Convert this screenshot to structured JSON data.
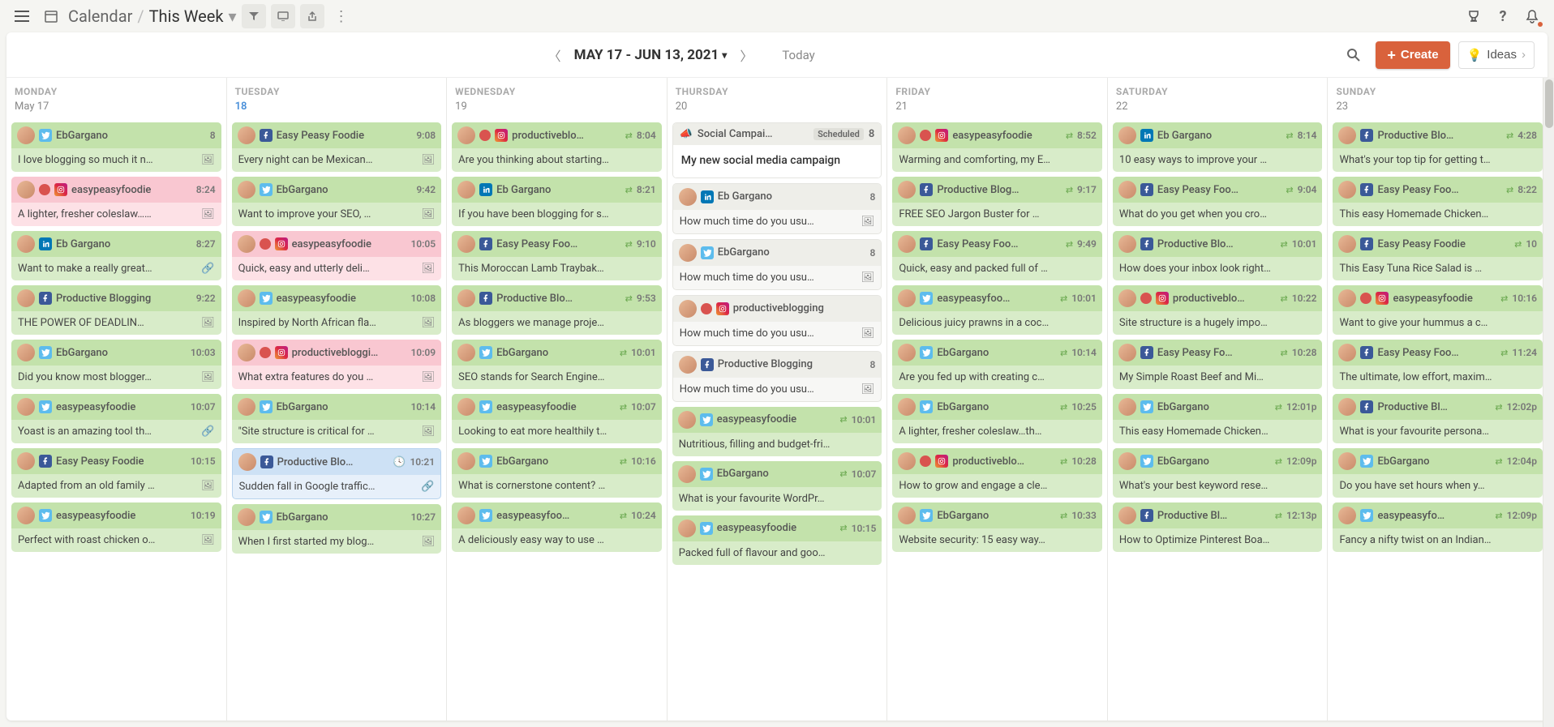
{
  "breadcrumb": {
    "app": "Calendar",
    "view": "This Week"
  },
  "controls": {
    "date_range": "MAY 17 - JUN 13, 2021",
    "today": "Today",
    "create": "Create",
    "ideas": "Ideas"
  },
  "days": [
    {
      "name": "MONDAY",
      "date": "May 17",
      "today": false
    },
    {
      "name": "TUESDAY",
      "date": "18",
      "today": true
    },
    {
      "name": "WEDNESDAY",
      "date": "19",
      "today": false
    },
    {
      "name": "THURSDAY",
      "date": "20",
      "today": false
    },
    {
      "name": "FRIDAY",
      "date": "21",
      "today": false
    },
    {
      "name": "SATURDAY",
      "date": "22",
      "today": false
    },
    {
      "name": "SUNDAY",
      "date": "23",
      "today": false
    }
  ],
  "cards": {
    "mon": [
      {
        "style": "green",
        "net": "tw",
        "acct": "EbGargano",
        "time": "8",
        "shuffle": false,
        "text": "I love blogging so much it n…",
        "img": true
      },
      {
        "style": "pink",
        "net": "ig",
        "acct": "easypeasyfoodie",
        "time": "8:24",
        "shuffle": false,
        "user": true,
        "text": "A lighter, fresher coleslaw……",
        "img": true
      },
      {
        "style": "green",
        "net": "li",
        "acct": "Eb Gargano",
        "time": "8:27",
        "shuffle": false,
        "text": "Want to make a really great…",
        "link": true
      },
      {
        "style": "green",
        "net": "fb",
        "acct": "Productive Blogging",
        "time": "9:22",
        "shuffle": false,
        "text": "THE POWER OF DEADLIN…",
        "img": true
      },
      {
        "style": "green",
        "net": "tw",
        "acct": "EbGargano",
        "time": "10:03",
        "shuffle": false,
        "text": "Did you know most blogger…",
        "img": true
      },
      {
        "style": "green",
        "net": "tw",
        "acct": "easypeasyfoodie",
        "time": "10:07",
        "shuffle": false,
        "text": "Yoast is an amazing tool th…",
        "link": true
      },
      {
        "style": "green",
        "net": "fb",
        "acct": "Easy Peasy Foodie",
        "time": "10:15",
        "shuffle": false,
        "text": "Adapted from an old family …",
        "img": true
      },
      {
        "style": "green",
        "net": "tw",
        "acct": "easypeasyfoodie",
        "time": "10:19",
        "shuffle": false,
        "text": "Perfect with roast chicken o…",
        "img": true
      }
    ],
    "tue": [
      {
        "style": "green",
        "net": "fb",
        "acct": "Easy Peasy Foodie",
        "time": "9:08",
        "shuffle": false,
        "text": "Every night can be Mexican…",
        "img": true
      },
      {
        "style": "green",
        "net": "tw",
        "acct": "EbGargano",
        "time": "9:42",
        "shuffle": false,
        "text": "Want to improve your SEO, …",
        "img": true
      },
      {
        "style": "pink",
        "net": "ig",
        "acct": "easypeasyfoodie",
        "time": "10:05",
        "shuffle": false,
        "user": true,
        "text": "Quick, easy and utterly deli…",
        "img": true
      },
      {
        "style": "green",
        "net": "tw",
        "acct": "easypeasyfoodie",
        "time": "10:08",
        "shuffle": false,
        "text": "Inspired by North African fla…",
        "img": true
      },
      {
        "style": "pink",
        "net": "ig",
        "acct": "productivebloggi…",
        "time": "10:09",
        "shuffle": false,
        "user": true,
        "text": "What extra features do you …",
        "img": true
      },
      {
        "style": "green",
        "net": "tw",
        "acct": "EbGargano",
        "time": "10:14",
        "shuffle": false,
        "text": "\"Site structure is critical for …",
        "img": true
      },
      {
        "style": "blue",
        "net": "fb",
        "acct": "Productive Blo…",
        "time": "10:21",
        "shuffle": false,
        "clock": true,
        "text": "Sudden fall in Google traffic…",
        "link": true
      },
      {
        "style": "green",
        "net": "tw",
        "acct": "EbGargano",
        "time": "10:27",
        "shuffle": false,
        "text": "When I first started my blog…",
        "img": true
      }
    ],
    "wed": [
      {
        "style": "green",
        "net": "ig",
        "acct": "productiveblo…",
        "time": "8:04",
        "shuffle": true,
        "user": true,
        "text": "Are you thinking about starting…"
      },
      {
        "style": "green",
        "net": "li",
        "acct": "Eb Gargano",
        "time": "8:21",
        "shuffle": true,
        "text": "If you have been blogging for s…"
      },
      {
        "style": "green",
        "net": "fb",
        "acct": "Easy Peasy Foo…",
        "time": "9:10",
        "shuffle": true,
        "text": "This Moroccan Lamb Traybak…"
      },
      {
        "style": "green",
        "net": "fb",
        "acct": "Productive Blo…",
        "time": "9:53",
        "shuffle": true,
        "text": "As bloggers we manage proje…"
      },
      {
        "style": "green",
        "net": "tw",
        "acct": "EbGargano",
        "time": "10:01",
        "shuffle": true,
        "text": "SEO stands for Search Engine…"
      },
      {
        "style": "green",
        "net": "tw",
        "acct": "easypeasyfoodie",
        "time": "10:07",
        "shuffle": true,
        "text": "Looking to eat more healthily t…"
      },
      {
        "style": "green",
        "net": "tw",
        "acct": "EbGargano",
        "time": "10:16",
        "shuffle": true,
        "text": "What is cornerstone content? …"
      },
      {
        "style": "green",
        "net": "tw",
        "acct": "easypeasyfoo…",
        "time": "10:24",
        "shuffle": true,
        "text": "A deliciously easy way to use …"
      }
    ],
    "thu": [
      {
        "style": "campaign",
        "title": "Social Campai…",
        "status": "Scheduled",
        "count": "8",
        "text": "My new social media campaign"
      },
      {
        "style": "gray",
        "net": "li",
        "acct": "Eb Gargano",
        "time": "8",
        "text": "How much time do you usu…",
        "img": true
      },
      {
        "style": "gray",
        "net": "tw",
        "acct": "EbGargano",
        "time": "8",
        "text": "How much time do you usu…",
        "img": true
      },
      {
        "style": "gray",
        "net": "ig",
        "acct": "productiveblogging",
        "time": "",
        "user": true,
        "text": "How much time do you usu…",
        "img": true
      },
      {
        "style": "gray",
        "net": "fb",
        "acct": "Productive Blogging",
        "time": "8",
        "text": "How much time do you usu…",
        "img": true
      },
      {
        "style": "green",
        "net": "tw",
        "acct": "easypeasyfoodie",
        "time": "10:01",
        "shuffle": true,
        "text": "Nutritious, filling and budget-fri…"
      },
      {
        "style": "green",
        "net": "tw",
        "acct": "EbGargano",
        "time": "10:07",
        "shuffle": true,
        "text": "What is your favourite WordPr…"
      },
      {
        "style": "green",
        "net": "tw",
        "acct": "easypeasyfoodie",
        "time": "10:15",
        "shuffle": true,
        "text": "Packed full of flavour and goo…"
      }
    ],
    "fri": [
      {
        "style": "green",
        "net": "ig",
        "acct": "easypeasyfoodie",
        "time": "8:52",
        "shuffle": true,
        "user": true,
        "text": "Warming and comforting, my E…"
      },
      {
        "style": "green",
        "net": "fb",
        "acct": "Productive Blog…",
        "time": "9:17",
        "shuffle": true,
        "text": "FREE SEO Jargon Buster for …"
      },
      {
        "style": "green",
        "net": "fb",
        "acct": "Easy Peasy Foo…",
        "time": "9:49",
        "shuffle": true,
        "text": "Quick, easy and packed full of …"
      },
      {
        "style": "green",
        "net": "tw",
        "acct": "easypeasyfoo…",
        "time": "10:01",
        "shuffle": true,
        "text": "Delicious juicy prawns in a coc…"
      },
      {
        "style": "green",
        "net": "tw",
        "acct": "EbGargano",
        "time": "10:14",
        "shuffle": true,
        "text": "Are you fed up with creating c…"
      },
      {
        "style": "green",
        "net": "tw",
        "acct": "EbGargano",
        "time": "10:25",
        "shuffle": true,
        "text": "A lighter, fresher coleslaw…th…"
      },
      {
        "style": "green",
        "net": "ig",
        "acct": "productiveblo…",
        "time": "10:28",
        "shuffle": true,
        "user": true,
        "text": "How to grow and engage a cle…"
      },
      {
        "style": "green",
        "net": "tw",
        "acct": "EbGargano",
        "time": "10:33",
        "shuffle": true,
        "text": "Website security: 15 easy way…"
      }
    ],
    "sat": [
      {
        "style": "green",
        "net": "li",
        "acct": "Eb Gargano",
        "time": "8:14",
        "shuffle": true,
        "text": "10 easy ways to improve your …"
      },
      {
        "style": "green",
        "net": "fb",
        "acct": "Easy Peasy Foo…",
        "time": "9:04",
        "shuffle": true,
        "text": "What do you get when you cro…"
      },
      {
        "style": "green",
        "net": "fb",
        "acct": "Productive Blo…",
        "time": "10:01",
        "shuffle": true,
        "text": "How does your inbox look right…"
      },
      {
        "style": "green",
        "net": "ig",
        "acct": "productiveblo…",
        "time": "10:22",
        "shuffle": true,
        "user": true,
        "text": "Site structure is a hugely impo…"
      },
      {
        "style": "green",
        "net": "fb",
        "acct": "Easy Peasy Fo…",
        "time": "10:28",
        "shuffle": true,
        "text": "My Simple Roast Beef and Mi…"
      },
      {
        "style": "green",
        "net": "tw",
        "acct": "EbGargano",
        "time": "12:01p",
        "shuffle": true,
        "text": "This easy Homemade Chicken…"
      },
      {
        "style": "green",
        "net": "tw",
        "acct": "EbGargano",
        "time": "12:09p",
        "shuffle": true,
        "text": "What's your best keyword rese…"
      },
      {
        "style": "green",
        "net": "fb",
        "acct": "Productive Bl…",
        "time": "12:13p",
        "shuffle": true,
        "text": "How to Optimize Pinterest Boa…"
      }
    ],
    "sun": [
      {
        "style": "green",
        "net": "fb",
        "acct": "Productive Blo…",
        "time": "4:28",
        "shuffle": true,
        "text": "What's your top tip for getting t…"
      },
      {
        "style": "green",
        "net": "fb",
        "acct": "Easy Peasy Foo…",
        "time": "8:22",
        "shuffle": true,
        "text": "This easy Homemade Chicken…"
      },
      {
        "style": "green",
        "net": "fb",
        "acct": "Easy Peasy Foodie",
        "time": "10",
        "shuffle": true,
        "text": "This Easy Tuna Rice Salad is …"
      },
      {
        "style": "green",
        "net": "ig",
        "acct": "easypeasyfoodie",
        "time": "10:16",
        "shuffle": true,
        "user": true,
        "text": "Want to give your hummus a c…"
      },
      {
        "style": "green",
        "net": "fb",
        "acct": "Easy Peasy Foo…",
        "time": "11:24",
        "shuffle": true,
        "text": "The ultimate, low effort, maxim…"
      },
      {
        "style": "green",
        "net": "fb",
        "acct": "Productive Bl…",
        "time": "12:02p",
        "shuffle": true,
        "text": "What is your favourite persona…"
      },
      {
        "style": "green",
        "net": "tw",
        "acct": "EbGargano",
        "time": "12:04p",
        "shuffle": true,
        "text": "Do you have set hours when y…"
      },
      {
        "style": "green",
        "net": "tw",
        "acct": "easypeasyfo…",
        "time": "12:09p",
        "shuffle": true,
        "text": "Fancy a nifty twist on an Indian…"
      }
    ]
  }
}
